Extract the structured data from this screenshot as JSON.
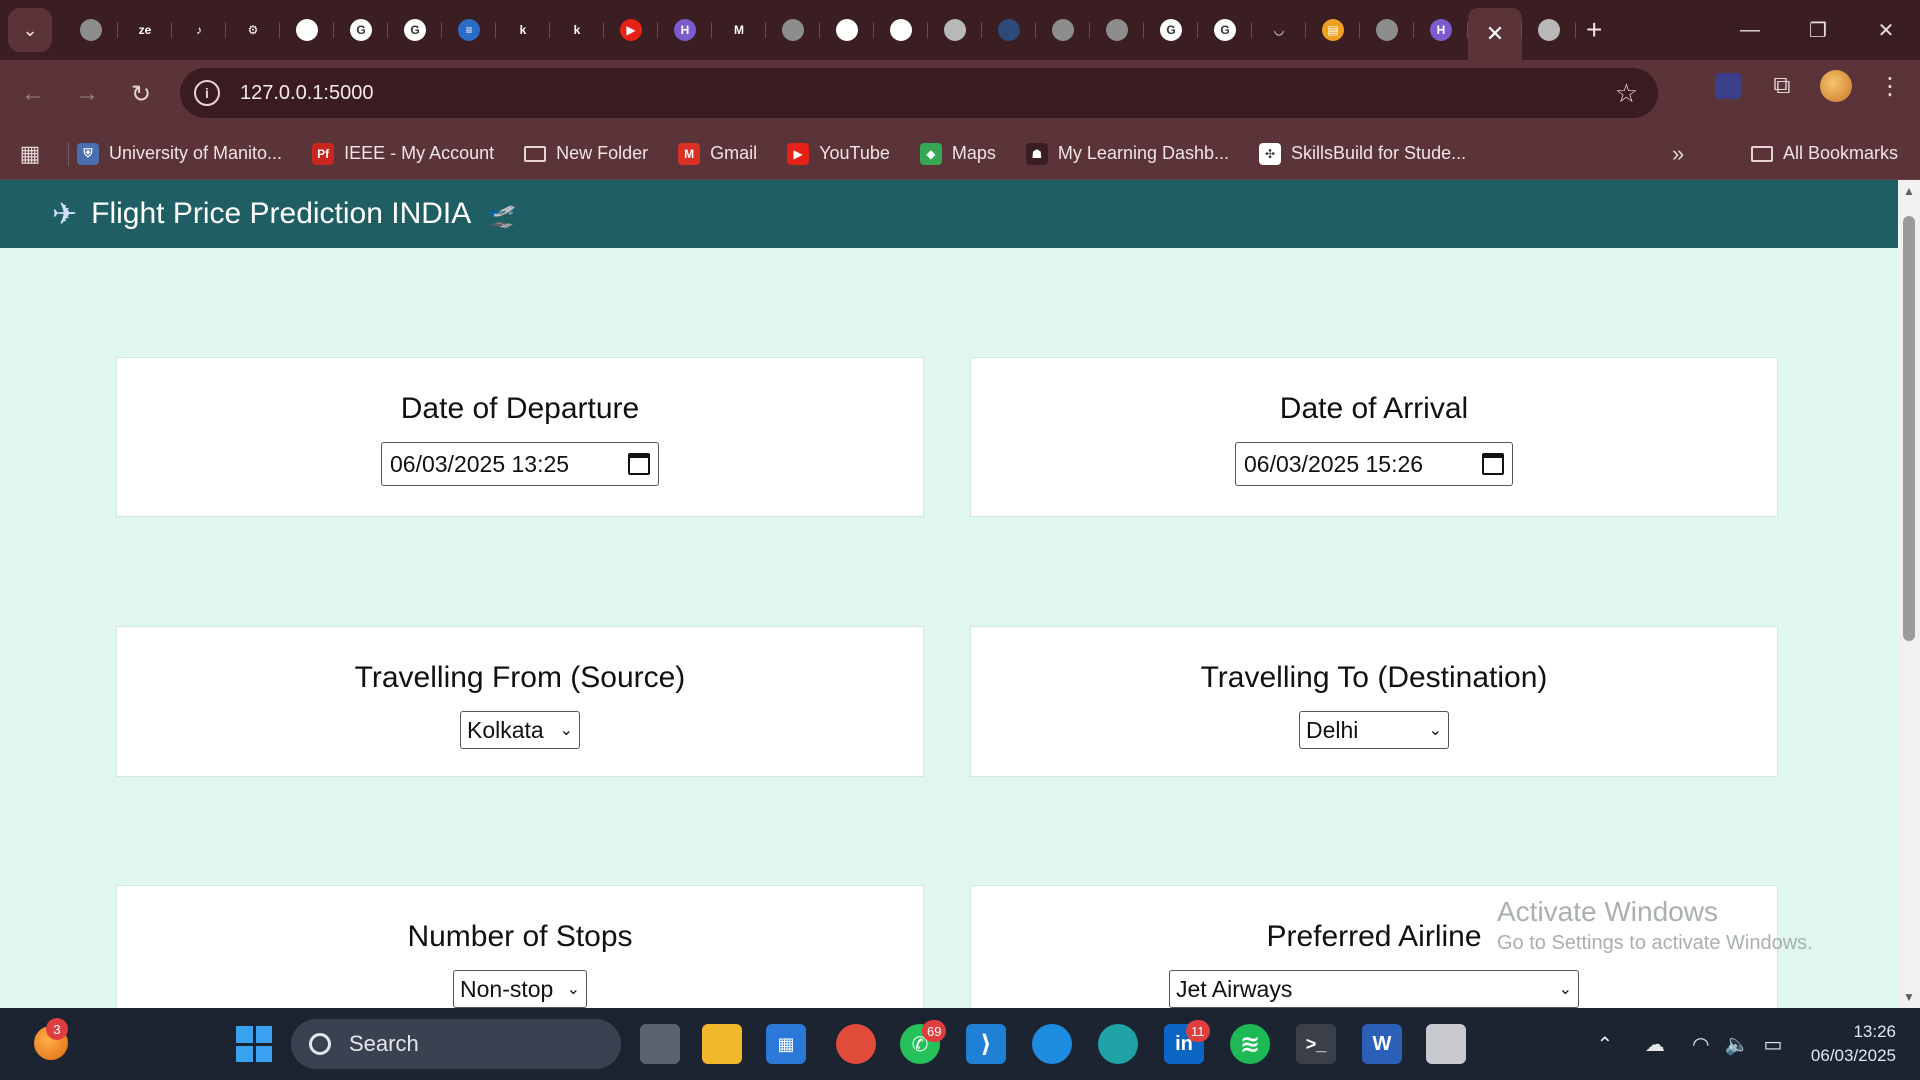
{
  "browser": {
    "active_tab_close": "✕",
    "new_tab": "+",
    "url": "127.0.0.1:5000",
    "tab_favicons": [
      {
        "icon": "globe-icon",
        "color": "#8d8d8d",
        "glyph": ""
      },
      {
        "icon": "ze-icon",
        "color": "#3b1e22",
        "glyph": "ze"
      },
      {
        "icon": "scribble-icon",
        "color": "#3b1e22",
        "glyph": "♪"
      },
      {
        "icon": "gear-icon",
        "color": "#3b1e22",
        "glyph": "⚙"
      },
      {
        "icon": "openai-icon",
        "color": "#ffffff",
        "glyph": ""
      },
      {
        "icon": "google-icon",
        "color": "#ffffff",
        "glyph": "G"
      },
      {
        "icon": "google-icon",
        "color": "#ffffff",
        "glyph": "G"
      },
      {
        "icon": "database-icon",
        "color": "#2a6cc6",
        "glyph": "≡"
      },
      {
        "icon": "k-icon",
        "color": "#3b1e22",
        "glyph": "k"
      },
      {
        "icon": "k-icon",
        "color": "#3b1e22",
        "glyph": "k"
      },
      {
        "icon": "youtube-icon",
        "color": "#e62117",
        "glyph": "▶"
      },
      {
        "icon": "h-icon",
        "color": "#7b5ccf",
        "glyph": "H"
      },
      {
        "icon": "gmail-icon",
        "color": "#3b1e22",
        "glyph": "M"
      },
      {
        "icon": "globe-icon",
        "color": "#8d8d8d",
        "glyph": ""
      },
      {
        "icon": "github-icon",
        "color": "#ffffff",
        "glyph": ""
      },
      {
        "icon": "github-icon",
        "color": "#ffffff",
        "glyph": ""
      },
      {
        "icon": "chrome-icon",
        "color": "#b8b8b8",
        "glyph": ""
      },
      {
        "icon": "circle-icon",
        "color": "#2d4a78",
        "glyph": ""
      },
      {
        "icon": "globe-icon",
        "color": "#8d8d8d",
        "glyph": ""
      },
      {
        "icon": "globe-icon",
        "color": "#8d8d8d",
        "glyph": ""
      },
      {
        "icon": "google-icon",
        "color": "#ffffff",
        "glyph": "G"
      },
      {
        "icon": "google-icon",
        "color": "#ffffff",
        "glyph": "G"
      },
      {
        "icon": "arc-icon",
        "color": "#3b1e22",
        "glyph": "◡"
      },
      {
        "icon": "notebook-icon",
        "color": "#f0a020",
        "glyph": "▤"
      },
      {
        "icon": "globe-icon",
        "color": "#8d8d8d",
        "glyph": ""
      },
      {
        "icon": "h-icon",
        "color": "#7b5ccf",
        "glyph": "H"
      }
    ],
    "bookmarks": [
      {
        "label": "University of Manito...",
        "icon": "shield-icon",
        "color": "#4a6fb0",
        "glyph": "⛨"
      },
      {
        "label": "IEEE - My Account",
        "icon": "pf-icon",
        "color": "#c8261e",
        "glyph": "Pf"
      },
      {
        "label": "New Folder",
        "icon": "folder-icon",
        "color": "",
        "glyph": ""
      },
      {
        "label": "Gmail",
        "icon": "gmail-icon",
        "color": "#d93025",
        "glyph": "M"
      },
      {
        "label": "YouTube",
        "icon": "youtube-icon",
        "color": "#e62117",
        "glyph": "▶"
      },
      {
        "label": "Maps",
        "icon": "maps-icon",
        "color": "#34a853",
        "glyph": "◆"
      },
      {
        "label": "My Learning Dashb...",
        "icon": "learning-icon",
        "color": "#3b1e22",
        "glyph": "☗"
      },
      {
        "label": "SkillsBuild for Stude...",
        "icon": "skillsbuild-icon",
        "color": "#ffffff",
        "glyph": "✣"
      }
    ],
    "more_bookmarks": "»",
    "all_bookmarks": "All Bookmarks"
  },
  "app": {
    "title": "Flight Price Prediction INDIA",
    "cards": {
      "departure": {
        "label": "Date of Departure",
        "value": "06/03/2025  13:25"
      },
      "arrival": {
        "label": "Date of Arrival",
        "value": "06/03/2025  15:26"
      },
      "source": {
        "label": "Travelling From (Source)",
        "value": "Kolkata"
      },
      "destination": {
        "label": "Travelling To (Destination)",
        "value": "Delhi"
      },
      "stops": {
        "label": "Number of Stops",
        "value": "Non-stop"
      },
      "airline": {
        "label": "Preferred Airline",
        "value": "Jet Airways"
      }
    }
  },
  "watermark": {
    "line1": "Activate Windows",
    "line2": "Go to Settings to activate Windows."
  },
  "taskbar": {
    "search_placeholder": "Search",
    "badges": {
      "left_app": "3",
      "whatsapp": "69",
      "linkedin": "11"
    },
    "time": "13:26",
    "date": "06/03/2025"
  }
}
